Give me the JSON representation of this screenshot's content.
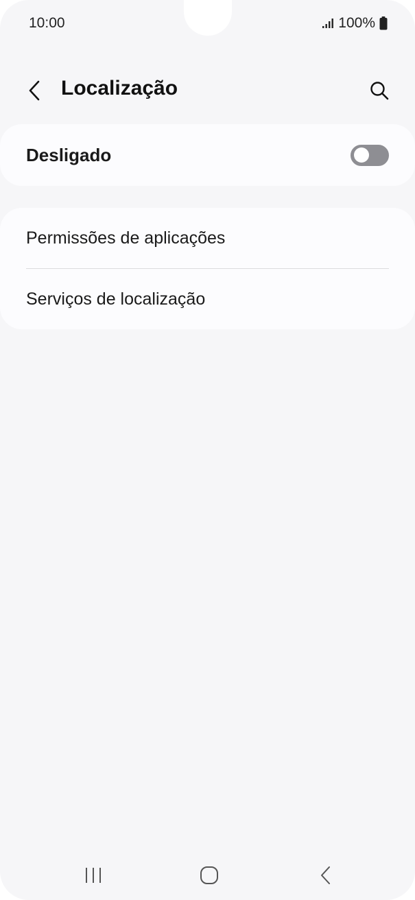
{
  "status_bar": {
    "time": "10:00",
    "battery_percent": "100%",
    "signal_icon": "signal-icon",
    "battery_icon": "battery-icon"
  },
  "header": {
    "title": "Localização",
    "back_icon": "chevron-left-icon",
    "search_icon": "search-icon"
  },
  "master_toggle": {
    "label": "Desligado",
    "state": "off"
  },
  "settings_list": {
    "items": [
      {
        "label": "Permissões de aplicações"
      },
      {
        "label": "Serviços de localização"
      }
    ]
  },
  "navigation_bar": {
    "recents_icon": "recents-icon",
    "home_icon": "home-icon",
    "back_icon": "back-icon"
  },
  "colors": {
    "background": "#f6f6f8",
    "card": "#fcfcfe",
    "toggle_off": "#8e8e93"
  }
}
